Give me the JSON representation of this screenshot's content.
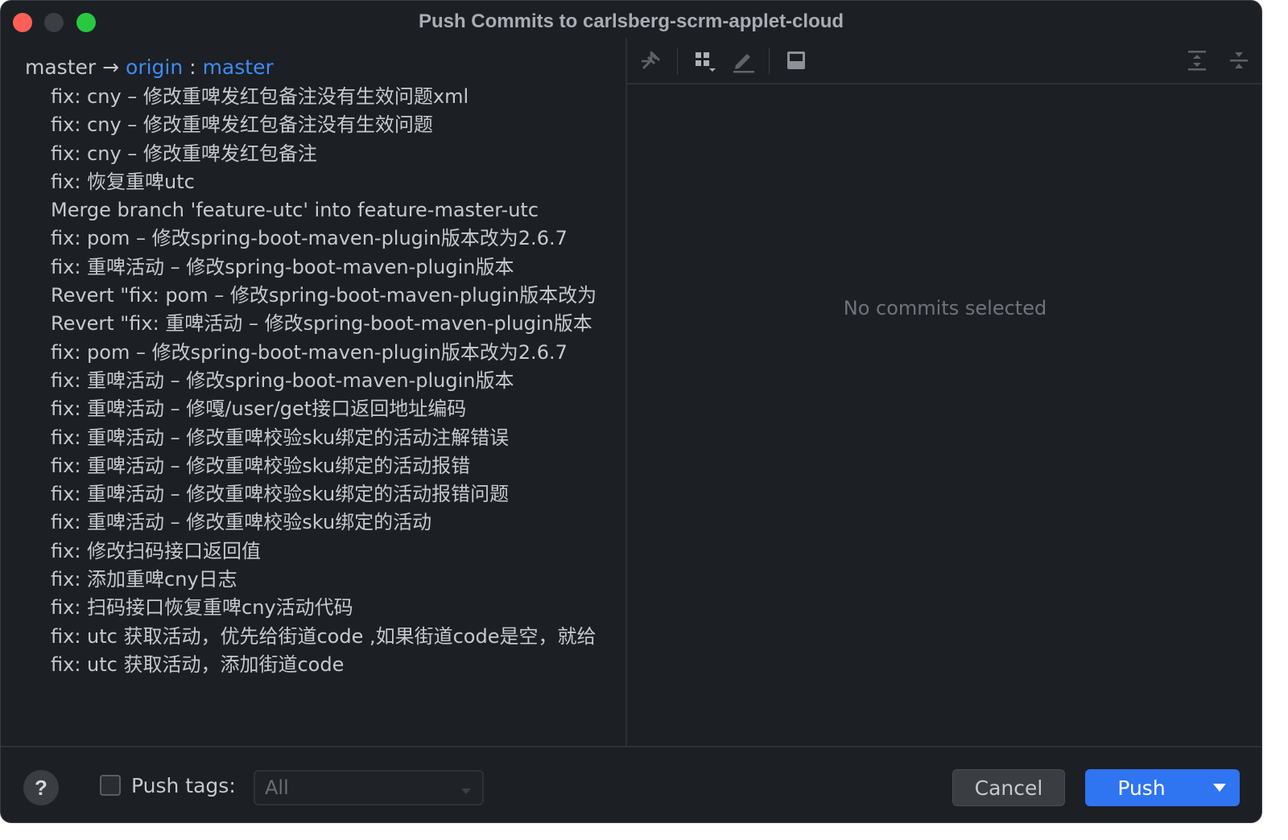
{
  "window": {
    "title": "Push Commits to carlsberg-scrm-applet-cloud"
  },
  "branch": {
    "local": "master",
    "arrow": "→",
    "remote": "origin",
    "separator": ":",
    "remote_branch": "master"
  },
  "commits": [
    "fix: cny – 修改重啤发红包备注没有生效问题xml",
    "fix: cny – 修改重啤发红包备注没有生效问题",
    "fix: cny – 修改重啤发红包备注",
    "fix: 恢复重啤utc",
    "Merge branch 'feature-utc' into feature-master-utc",
    "fix: pom – 修改spring-boot-maven-plugin版本改为2.6.7",
    "fix: 重啤活动 – 修改spring-boot-maven-plugin版本",
    "Revert \"fix: pom – 修改spring-boot-maven-plugin版本改为",
    "Revert \"fix: 重啤活动 – 修改spring-boot-maven-plugin版本",
    "fix: pom – 修改spring-boot-maven-plugin版本改为2.6.7",
    "fix: 重啤活动 – 修改spring-boot-maven-plugin版本",
    "fix: 重啤活动 – 修嘎/user/get接口返回地址编码",
    "fix: 重啤活动 – 修改重啤校验sku绑定的活动注解错误",
    "fix: 重啤活动 – 修改重啤校验sku绑定的活动报错",
    "fix: 重啤活动 – 修改重啤校验sku绑定的活动报错问题",
    "fix: 重啤活动 – 修改重啤校验sku绑定的活动",
    "fix: 修改扫码接口返回值",
    "fix: 添加重啤cny日志",
    "fix: 扫码接口恢复重啤cny活动代码",
    "fix: utc 获取活动，优先给街道code ,如果街道code是空，就给",
    "fix: utc 获取活动，添加街道code"
  ],
  "details": {
    "empty_message": "No commits selected"
  },
  "toolbar": {
    "icons": [
      "pin-icon",
      "group-icon",
      "edit-icon",
      "preview-icon",
      "expand-all-icon",
      "collapse-all-icon"
    ]
  },
  "footer": {
    "help_label": "?",
    "push_tags_label": "Push tags:",
    "push_tags_checked": false,
    "push_tags_value": "All",
    "cancel_label": "Cancel",
    "push_label": "Push"
  },
  "colors": {
    "background": "#1c1f24",
    "accent": "#2f74f0",
    "remote_link": "#3d8bf5",
    "close": "#ff5f57",
    "maximize": "#28c840"
  }
}
